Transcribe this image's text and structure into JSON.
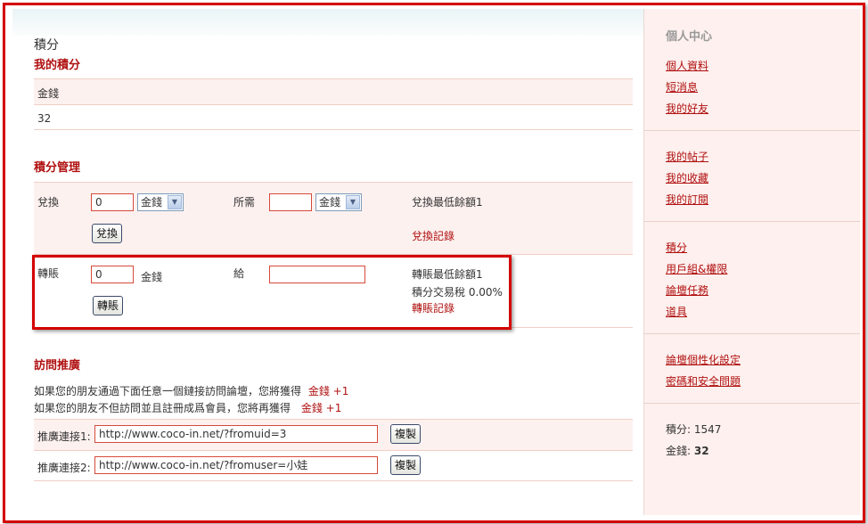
{
  "page": {
    "title": "積分"
  },
  "my_points": {
    "heading": "我的積分",
    "currency_label": "金錢",
    "currency_value": "32"
  },
  "management": {
    "heading": "積分管理",
    "exchange": {
      "label": "兌換",
      "amount_value": "0",
      "from_select": "金錢",
      "required_label": "所需",
      "required_value": "",
      "to_select": "金錢",
      "min_note": "兌換最低餘額1",
      "button": "兌換",
      "record_link": "兌換記錄"
    },
    "transfer": {
      "label": "轉賬",
      "amount_value": "0",
      "currency": "金錢",
      "to_label": "給",
      "to_value": "",
      "min_note": "轉賬最低餘額1",
      "tax_note": "積分交易稅 0.00%",
      "button": "轉賬",
      "record_link": "轉賬記錄"
    }
  },
  "referral": {
    "heading": "訪問推廣",
    "line1_text": "如果您的朋友通過下面任意一個鏈接訪問論壇，您將獲得",
    "line1_reward": "金錢 +1",
    "line2_text": "如果您的朋友不但訪問並且註冊成爲會員，您將再獲得",
    "line2_reward": "金錢 +1",
    "link1_label": "推廣連接1:",
    "link1_value": "http://www.coco-in.net/?fromuid=3",
    "link2_label": "推廣連接2:",
    "link2_value": "http://www.coco-in.net/?fromuser=小娃",
    "copy_button": "複製"
  },
  "sidebar": {
    "heading": "個人中心",
    "group1": [
      "個人資料",
      "短消息",
      "我的好友"
    ],
    "group2": [
      "我的帖子",
      "我的收藏",
      "我的訂閱"
    ],
    "group3": [
      "積分",
      "用戶組&權限",
      "論壇任務",
      "道具"
    ],
    "group4": [
      "論壇個性化設定",
      "密碼和安全問題"
    ],
    "stats": {
      "points_label": "積分: 1547",
      "money_label": "金錢:",
      "money_value": "32"
    }
  },
  "colors": {
    "accent": "#b01010",
    "frame": "#d40000",
    "sidebar_bg": "#fdf0ee"
  }
}
